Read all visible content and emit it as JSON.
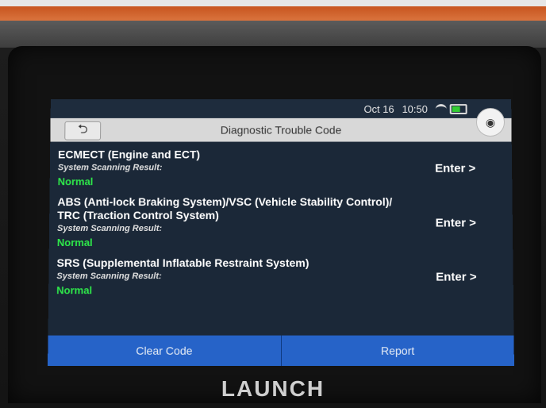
{
  "status_bar": {
    "date": "Oct 16",
    "time": "10:50"
  },
  "header": {
    "title": "Diagnostic Trouble Code",
    "back_icon": "back-arrow-icon",
    "exit_icon": "exit-icon"
  },
  "camera_icon": "camera-icon",
  "systems": [
    {
      "name": "ECMECT (Engine and ECT)",
      "scan_label": "System Scanning Result:",
      "status": "Normal",
      "action": "Enter >"
    },
    {
      "name": "ABS (Anti-lock Braking System)/VSC (Vehicle Stability Control)/ TRC (Traction Control System)",
      "scan_label": "System Scanning Result:",
      "status": "Normal",
      "action": "Enter >"
    },
    {
      "name": "SRS (Supplemental Inflatable Restraint System)",
      "scan_label": "System Scanning Result:",
      "status": "Normal",
      "action": "Enter >"
    }
  ],
  "footer": {
    "clear_label": "Clear Code",
    "report_label": "Report"
  },
  "brand": "LAUNCH",
  "colors": {
    "accent": "#2663c8",
    "normal_status": "#2ee84a",
    "screen_bg": "#1b2838"
  }
}
